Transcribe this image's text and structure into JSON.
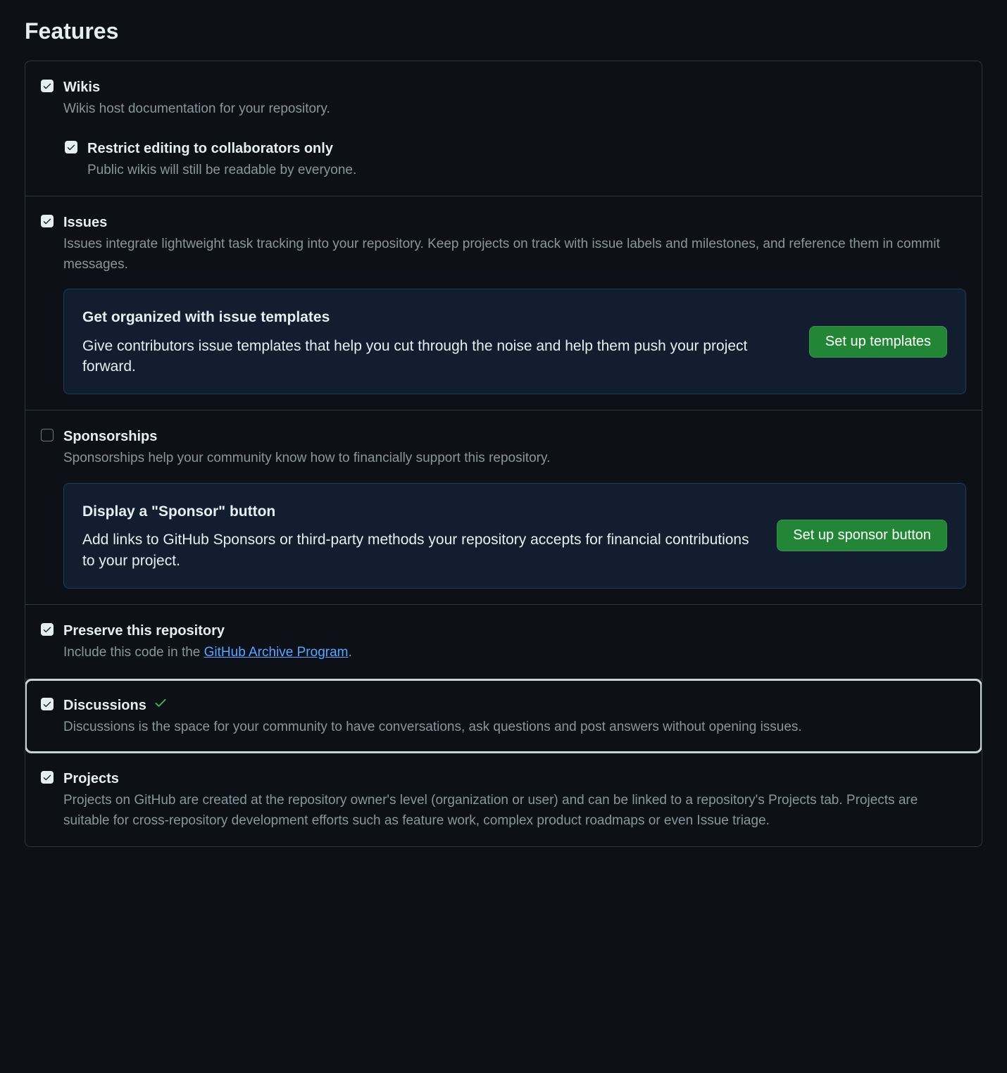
{
  "heading": "Features",
  "features": {
    "wikis": {
      "title": "Wikis",
      "desc": "Wikis host documentation for your repository.",
      "checked": true,
      "sub": {
        "title": "Restrict editing to collaborators only",
        "desc": "Public wikis will still be readable by everyone.",
        "checked": true
      }
    },
    "issues": {
      "title": "Issues",
      "desc": "Issues integrate lightweight task tracking into your repository. Keep projects on track with issue labels and milestones, and reference them in commit messages.",
      "checked": true,
      "callout": {
        "title": "Get organized with issue templates",
        "desc": "Give contributors issue templates that help you cut through the noise and help them push your project forward.",
        "button": "Set up templates"
      }
    },
    "sponsorships": {
      "title": "Sponsorships",
      "desc": "Sponsorships help your community know how to financially support this repository.",
      "checked": false,
      "callout": {
        "title": "Display a \"Sponsor\" button",
        "desc": "Add links to GitHub Sponsors or third-party methods your repository accepts for financial contributions to your project.",
        "button": "Set up sponsor button"
      }
    },
    "preserve": {
      "title": "Preserve this repository",
      "desc_pre": "Include this code in the ",
      "link": "GitHub Archive Program",
      "desc_post": ".",
      "checked": true
    },
    "discussions": {
      "title": "Discussions",
      "desc": "Discussions is the space for your community to have conversations, ask questions and post answers without opening issues.",
      "checked": true,
      "highlighted": true,
      "success_icon": true
    },
    "projects": {
      "title": "Projects",
      "desc": "Projects on GitHub are created at the repository owner's level (organization or user) and can be linked to a repository's Projects tab. Projects are suitable for cross-repository development efforts such as feature work, complex product roadmaps or even Issue triage.",
      "checked": true
    }
  }
}
